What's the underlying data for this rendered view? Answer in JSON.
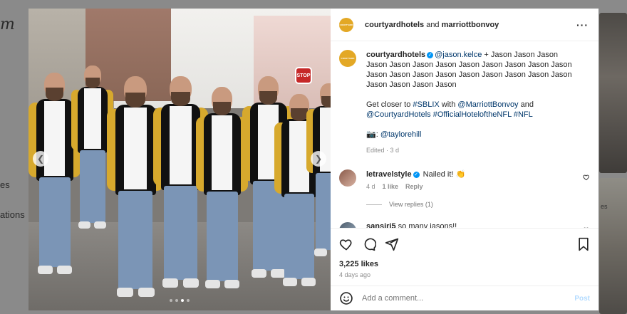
{
  "background": {
    "logo_fragment": "m",
    "sidebar_fragment_1": "es",
    "sidebar_fragment_2": "ations",
    "right_thumb_label": "es"
  },
  "media": {
    "stop_sign_text": "STOP",
    "carousel": {
      "total": 4,
      "active_index": 2
    }
  },
  "header": {
    "avatar_text": "COURTYARD",
    "account_1": "courtyardhotels",
    "joiner": " and ",
    "account_2": "marriottbonvoy",
    "more_icon": "more-horizontal-icon"
  },
  "caption": {
    "author": "courtyardhotels",
    "mention_lead": "@jason.kelce",
    "text_lead": " + Jason Jason Jason Jason Jason Jason Jason Jason Jason Jason Jason Jason Jason Jason Jason Jason Jason Jason Jason Jason Jason Jason Jason Jason Jason",
    "line2_prefix": "Get closer to ",
    "tag_sblix": "#SBLIX",
    "line2_with": " with ",
    "mention_marriott": "@MarriottBonvoy",
    "line2_and": " and",
    "mention_courtyard": "@CourtyardHotels",
    "tag_official": "#OfficialHoteloftheNFL",
    "tag_nfl": "#NFL",
    "credit_prefix": "📷: ",
    "mention_taylor": "@taylorehill",
    "edited": "Edited · 3 d"
  },
  "comments": [
    {
      "user": "letravelstyle",
      "text": "Nailed it! 👏",
      "age": "4 d",
      "likes": "1 like",
      "reply": "Reply",
      "view_replies": "View replies (1)"
    },
    {
      "user": "sansiri5",
      "text": "so many jasons!!"
    }
  ],
  "actions": {
    "likes": "3,225 likes",
    "time": "4 days ago"
  },
  "add_comment": {
    "placeholder": "Add a comment...",
    "post_label": "Post"
  },
  "colors": {
    "verified": "#0095f6",
    "link": "#00376b",
    "brand_avatar": "#e3a825",
    "post_disabled": "#b3dbff"
  }
}
